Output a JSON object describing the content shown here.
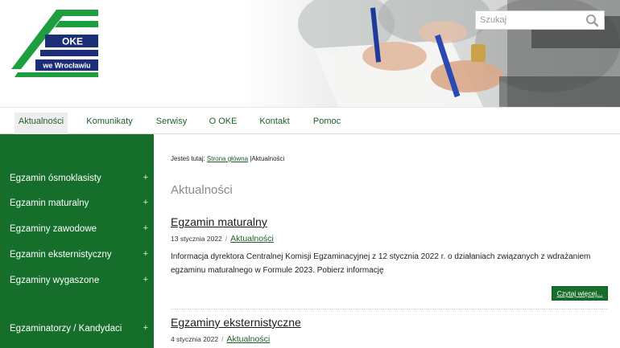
{
  "logo": {
    "text": "OKE",
    "subtext": "we Wrocławiu",
    "green": "#1e9e3e",
    "navy": "#1d2e78"
  },
  "search": {
    "placeholder": "Szukaj"
  },
  "nav": {
    "items": [
      {
        "label": "Aktualności",
        "active": true
      },
      {
        "label": "Komunikaty"
      },
      {
        "label": "Serwisy"
      },
      {
        "label": "O OKE"
      },
      {
        "label": "Kontakt"
      },
      {
        "label": "Pomoc"
      }
    ]
  },
  "sidebar": {
    "items": [
      {
        "label": "Egzamin ósmoklasisty",
        "toggle": "+"
      },
      {
        "label": "Egzamin maturalny",
        "toggle": "+"
      },
      {
        "label": "Egzaminy zawodowe",
        "toggle": "+"
      },
      {
        "label": "Egzamin eksternistyczny",
        "toggle": "+"
      },
      {
        "label": "Egzaminy wygaszone",
        "toggle": "+"
      },
      {
        "label": "Egzaminatorzy / Kandydaci",
        "toggle": "+"
      }
    ]
  },
  "breadcrumb": {
    "prefix": "Jesteś tutaj:",
    "home": "Strona główna",
    "separator": "|",
    "current": "Aktualności"
  },
  "page": {
    "title": "Aktualności"
  },
  "articles": [
    {
      "title": "Egzamin maturalny",
      "date": "13 stycznia 2022",
      "separator": "/",
      "category": "Aktualności",
      "excerpt": "Informacja dyrektora Centralnej Komisji Egzaminacyjnej z 12 stycznia 2022 r. o działaniach związanych z wdrażaniem egzaminu maturalnego w Formule 2023. Pobierz informację",
      "read_more": "Czytaj więcej..."
    },
    {
      "title": "Egzaminy eksternistyczne",
      "date": "4 stycznia 2022",
      "separator": "/",
      "category": "Aktualności"
    }
  ],
  "colors": {
    "brand_green": "#156f2b",
    "link_green": "#1d5e2a"
  }
}
